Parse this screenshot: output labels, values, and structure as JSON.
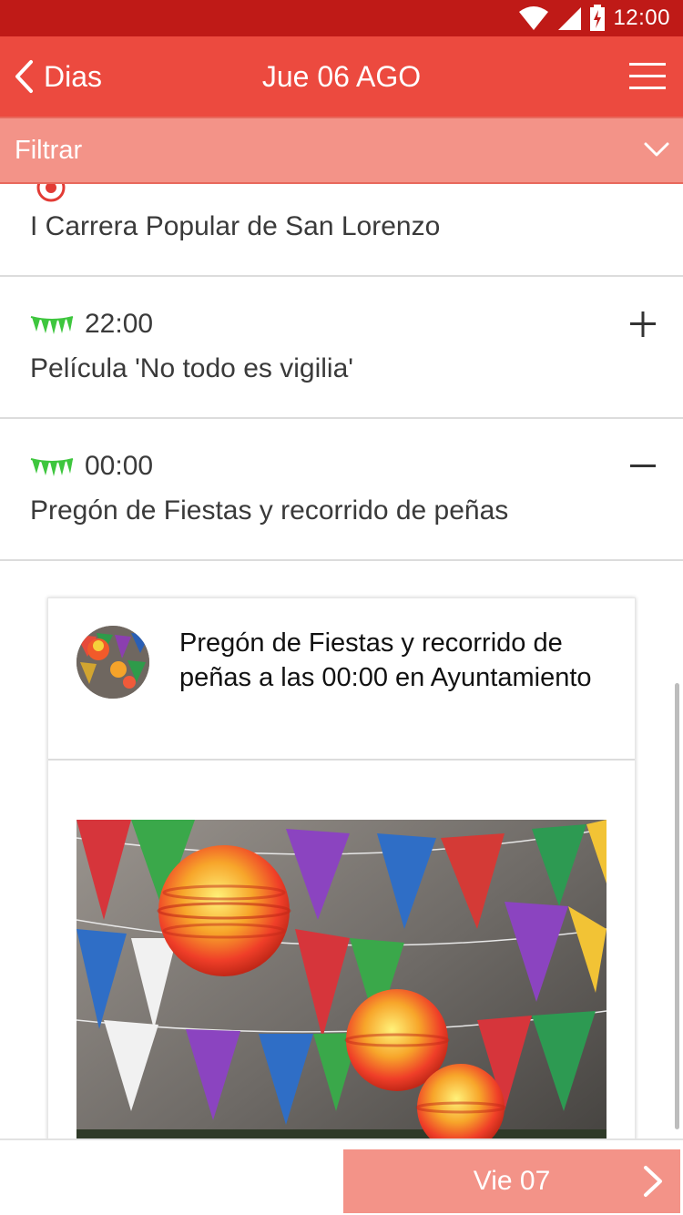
{
  "status_bar": {
    "time": "12:00"
  },
  "nav": {
    "back_label": "Dias",
    "title": "Jue 06 AGO"
  },
  "filter": {
    "label": "Filtrar"
  },
  "events": [
    {
      "time": "",
      "title": "I Carrera Popular de San Lorenzo",
      "icon": "target-icon"
    },
    {
      "time": "22:00",
      "title": "Película 'No todo es vigilia'",
      "icon": "bunting-icon",
      "expanded": false
    },
    {
      "time": "00:00",
      "title": "Pregón de Fiestas y recorrido de peñas",
      "icon": "bunting-icon",
      "expanded": true
    }
  ],
  "detail": {
    "text": "Pregón de Fiestas y recorrido de peñas a las 00:00 en Ayuntamiento",
    "avatar": "festival-lanterns-avatar",
    "photo": "paper-lanterns-bunting-photo"
  },
  "footer": {
    "next_label": "Vie 07"
  },
  "colors": {
    "status_bar": "#bf1a17",
    "nav_bar": "#ec4a3f",
    "filter_bar": "#f39388",
    "bunting_green": "#3ec63e"
  }
}
